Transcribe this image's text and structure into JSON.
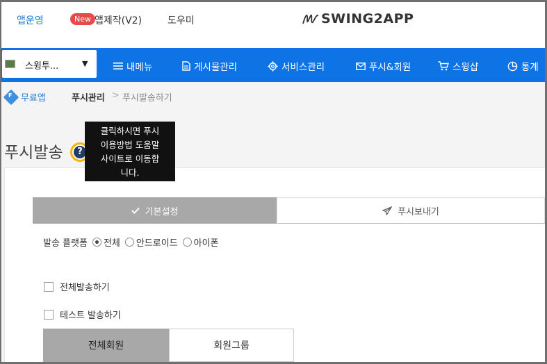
{
  "topbar": {
    "links": [
      "앱운영",
      "앱제작(V2)",
      "도우미"
    ],
    "new_badge": "New",
    "logo_text": "SWING2APP"
  },
  "nav": {
    "app_name": "스윙투...",
    "items": [
      "내메뉴",
      "게시물관리",
      "서비스관리",
      "푸시&회원",
      "스윙샵",
      "통계"
    ]
  },
  "breadcrumb": {
    "free_badge": "F",
    "free_app": "무료앱",
    "section": "푸시관리",
    "separator": ">",
    "current": "푸시발송하기"
  },
  "page": {
    "title": "푸시발송",
    "help_glyph": "?",
    "tooltip": "클릭하시면 푸시\n이용방법 도움말\n사이트로 이동합\n니다."
  },
  "tabs": {
    "basic": "기본설정",
    "send": "푸시보내기"
  },
  "platform": {
    "label": "발송 플랫폼",
    "options": [
      "전체",
      "안드로이드",
      "아이폰"
    ],
    "selected": "전체"
  },
  "checkboxes": {
    "send_all": "전체발송하기",
    "test_send": "테스트 발송하기"
  },
  "member_tabs": {
    "all": "전체회원",
    "group": "회원그룹"
  },
  "colors": {
    "nav_blue": "#0e74e6",
    "accent_blue": "#1e7fd8",
    "new_red": "#e54b4b",
    "highlight_ring": "#f2b400",
    "tab_gray": "#a8a8a8"
  }
}
